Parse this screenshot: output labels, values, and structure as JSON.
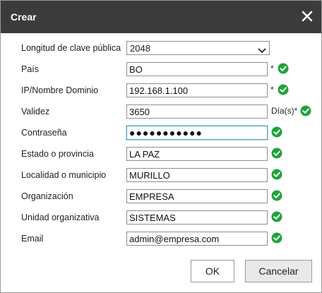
{
  "dialog": {
    "title": "Crear",
    "close_icon": "close-x-icon"
  },
  "form": {
    "key_length": {
      "label": "Longitud de clave pública",
      "value": "2048"
    },
    "country": {
      "label": "País",
      "value": "BO",
      "required_mark": "*"
    },
    "ip_domain": {
      "label": "IP/Nombre Dominio",
      "value": "192.168.1.100",
      "required_mark": "*"
    },
    "validity": {
      "label": "Validez",
      "value": "3650",
      "unit": "Día(s)*"
    },
    "password": {
      "label": "Contraseña",
      "value": "●●●●●●●●●●●"
    },
    "state": {
      "label": "Estado o provincia",
      "value": "LA PAZ"
    },
    "locality": {
      "label": "Localidad o municipio",
      "value": "MURILLO"
    },
    "organization": {
      "label": "Organización",
      "value": "EMPRESA"
    },
    "org_unit": {
      "label": "Unidad organizativa",
      "value": "SISTEMAS"
    },
    "email": {
      "label": "Email",
      "value": "admin@empresa.com"
    }
  },
  "buttons": {
    "ok_label": "OK",
    "cancel_label": "Cancelar"
  },
  "colors": {
    "titlebar": "#3b3b3b",
    "valid_check": "#1fa33a",
    "focus_border": "#5aa7b7"
  },
  "icons": {
    "valid": "check-circle-icon",
    "dropdown": "chevron-down-icon"
  }
}
